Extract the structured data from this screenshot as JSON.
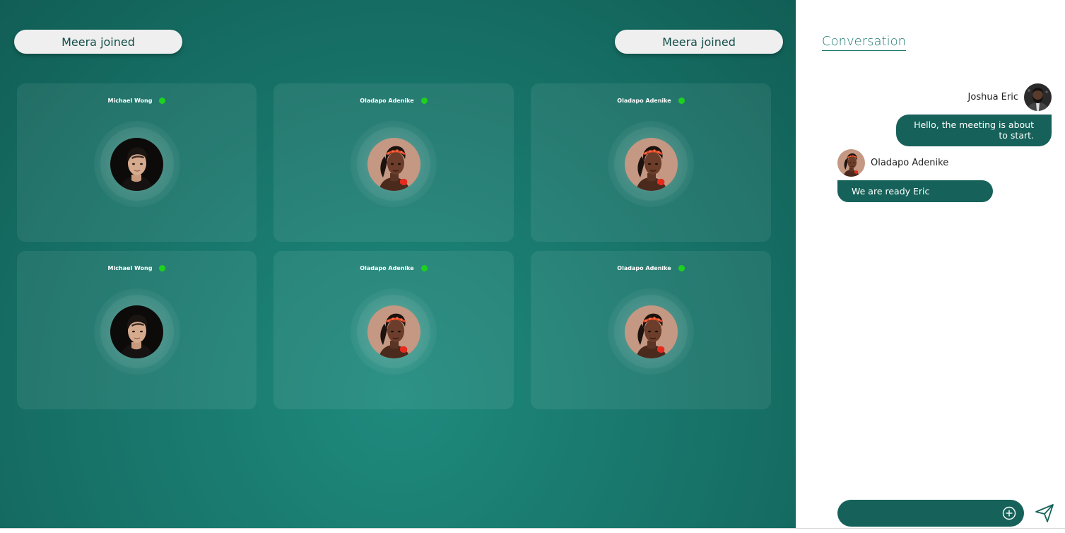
{
  "colors": {
    "stage_bg": "#177066",
    "accent": "#16625a",
    "status_online": "#1fd11f",
    "toast_bg": "#efefef"
  },
  "notifications": [
    {
      "text": "Meera joined"
    },
    {
      "text": "Meera joined"
    }
  ],
  "participants": [
    {
      "name": "Michael Wong",
      "status": "online",
      "avatar": "man-portrait"
    },
    {
      "name": "Oladapo Adenike",
      "status": "online",
      "avatar": "woman-portrait"
    },
    {
      "name": "Oladapo Adenike",
      "status": "online",
      "avatar": "woman-portrait"
    },
    {
      "name": "Michael Wong",
      "status": "online",
      "avatar": "man-portrait"
    },
    {
      "name": "Oladapo Adenike",
      "status": "online",
      "avatar": "woman-portrait"
    },
    {
      "name": "Oladapo Adenike",
      "status": "online",
      "avatar": "woman-portrait"
    }
  ],
  "chat": {
    "title": "Conversation",
    "messages": [
      {
        "sender": "Joshua Eric",
        "direction": "outgoing",
        "text": "Hello, the meeting is about to start."
      },
      {
        "sender": "Oladapo Adenike",
        "direction": "incoming",
        "text": "We are ready Eric"
      }
    ],
    "composer": {
      "placeholder": "",
      "add_icon": "plus-circle-icon",
      "send_icon": "send-icon"
    }
  }
}
